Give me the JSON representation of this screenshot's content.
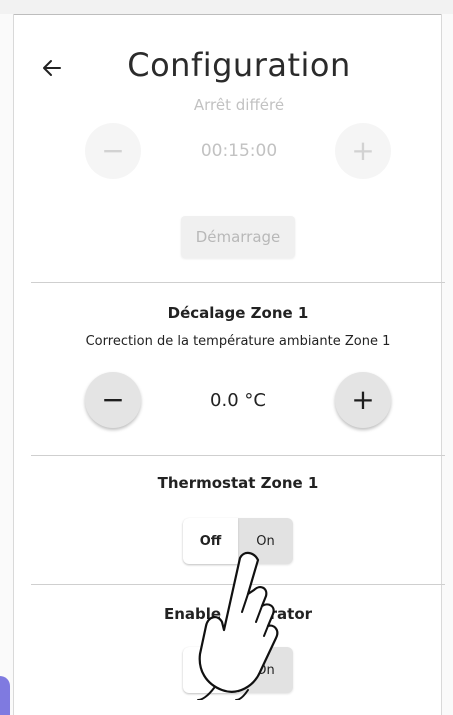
{
  "header": {
    "title": "Configuration",
    "back_icon": "arrow-left-icon"
  },
  "faded_section": {
    "label": "Arrêt différé",
    "value": "00:15:00",
    "minus": "−",
    "plus": "+",
    "start_label": "Démarrage"
  },
  "offset_section": {
    "title": "Décalage Zone 1",
    "description": "Correction de la température ambiante Zone 1",
    "value": "0.0 °C",
    "minus": "−",
    "plus": "+"
  },
  "thermostat_section": {
    "title": "Thermostat Zone 1",
    "off_label": "Off",
    "on_label": "On",
    "selected": "Off"
  },
  "enable_section": {
    "title": "Enable Generator",
    "off_label": "Off",
    "on_label": "On",
    "selected": "Off"
  },
  "colors": {
    "accent": "#7f7ae0",
    "button_gray": "#e4e4e4",
    "divider": "#cfcfcf"
  }
}
